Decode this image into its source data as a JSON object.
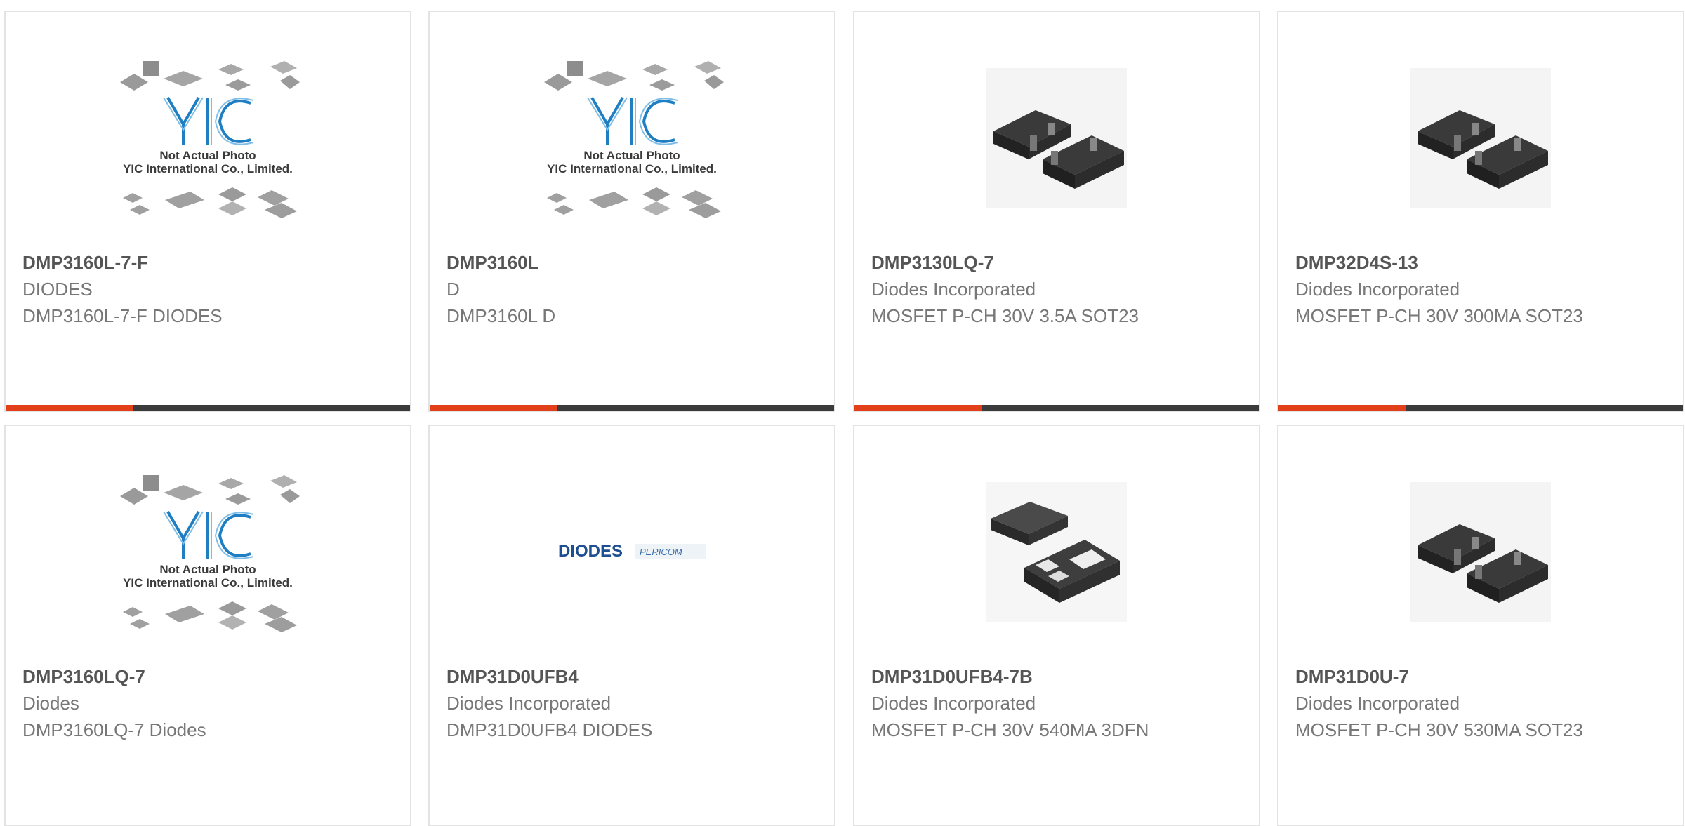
{
  "products": [
    {
      "part": "DMP3160L-7-F",
      "manufacturer": "DIODES",
      "description": "DMP3160L-7-F DIODES",
      "image": "yic-placeholder"
    },
    {
      "part": "DMP3160L",
      "manufacturer": "D",
      "description": "DMP3160L D",
      "image": "yic-placeholder"
    },
    {
      "part": "DMP3130LQ-7",
      "manufacturer": "Diodes Incorporated",
      "description": "MOSFET P-CH 30V 3.5A SOT23",
      "image": "sot23-package"
    },
    {
      "part": "DMP32D4S-13",
      "manufacturer": "Diodes Incorporated",
      "description": "MOSFET P-CH 30V 300MA SOT23",
      "image": "sot23-package"
    },
    {
      "part": "DMP3160LQ-7",
      "manufacturer": "Diodes",
      "description": "DMP3160LQ-7 Diodes",
      "image": "yic-placeholder"
    },
    {
      "part": "DMP31D0UFB4",
      "manufacturer": "Diodes Incorporated",
      "description": "DMP31D0UFB4 DIODES",
      "image": "diodes-pericom-logo"
    },
    {
      "part": "DMP31D0UFB4-7B",
      "manufacturer": "Diodes Incorporated",
      "description": "MOSFET P-CH 30V 540MA 3DFN",
      "image": "dfn-package"
    },
    {
      "part": "DMP31D0U-7",
      "manufacturer": "Diodes Incorporated",
      "description": "MOSFET P-CH 30V 530MA SOT23",
      "image": "sot23-package"
    }
  ],
  "placeholder": {
    "line1": "Not Actual Photo",
    "line2": "YIC International Co., Limited.",
    "mark": "YIC"
  },
  "logo": {
    "brand": "DIODES",
    "partner": "PERICOM"
  },
  "colors": {
    "accent": "#e2401b",
    "bar": "#3b3b3b",
    "border": "#e3e3e3",
    "yic_blue": "#1f7fc2"
  }
}
